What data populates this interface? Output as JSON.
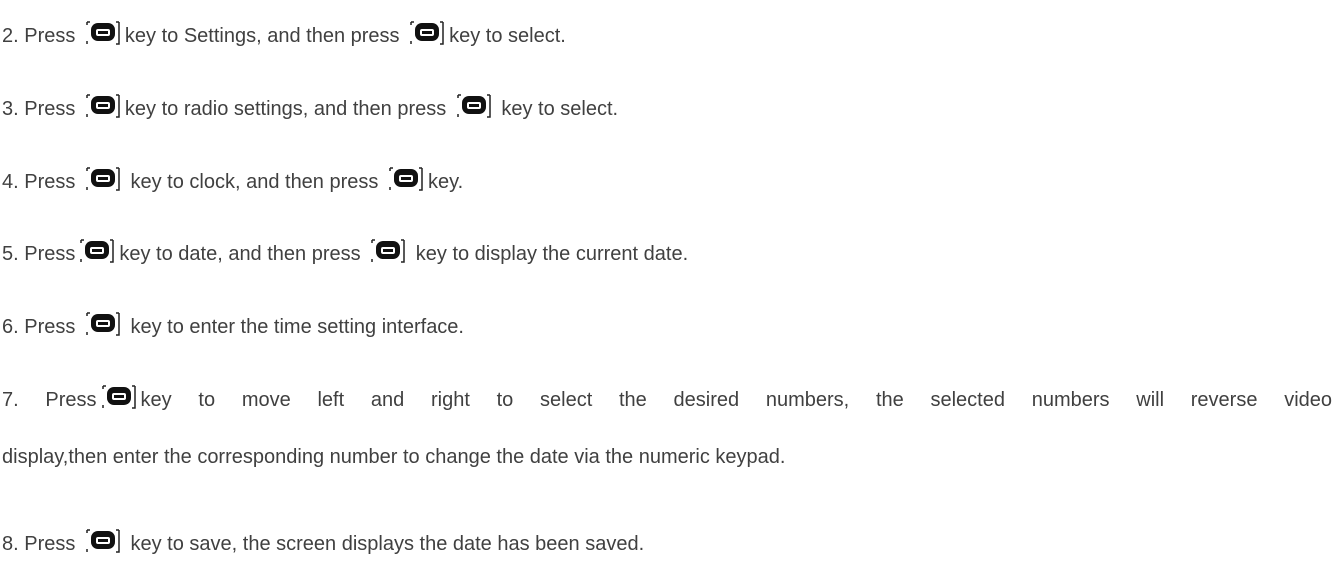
{
  "icons": {
    "key_icon": "select-key-icon"
  },
  "steps": [
    {
      "a": "2. Press",
      "b": "key to Settings, and then press",
      "c": "key to select."
    },
    {
      "a": "3. Press",
      "b": "key to radio settings, and then press",
      "c": "key to select."
    },
    {
      "a": "4. Press",
      "b": "key to clock, and then press",
      "c": "key."
    },
    {
      "a": "5. Press",
      "b": "key to date, and then press",
      "c": "key to display the current date."
    },
    {
      "a": "6. Press",
      "b": "key to enter the time setting interface."
    },
    {
      "a": "7. Press",
      "b": "key to move left and right to select the desired numbers, the selected numbers will reverse video",
      "line2": "display,then enter the corresponding number to change the date via the numeric keypad."
    },
    {
      "a": "8. Press",
      "b": "key to save, the screen displays the date has been saved."
    }
  ]
}
